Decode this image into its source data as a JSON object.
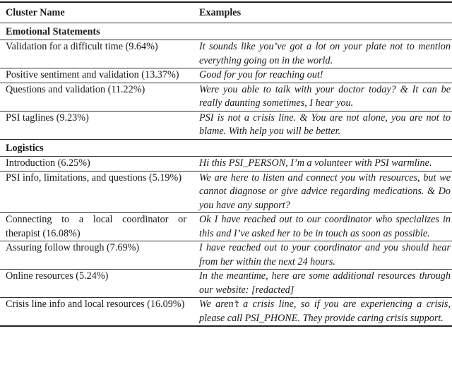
{
  "table": {
    "headers": [
      "Cluster Name",
      "Examples"
    ],
    "sections": [
      {
        "title": "Emotional Statements",
        "rows": [
          {
            "name": "Validation for a difficult time (9.64%)",
            "example": "It sounds like you’ve got a lot on your plate not to men­tion everything going on in the world."
          },
          {
            "name": "Positive sentiment and validation (13.37%)",
            "example": "Good for you for reaching out!"
          },
          {
            "name": "Questions and validation (11.22%)",
            "example": "Were you able to talk with your doctor today? & It can be really daunting sometimes, I hear you."
          },
          {
            "name": "PSI taglines (9.23%)",
            "example": "PSI is not a crisis line.  & You are not alone, you are not to blame. With help you will be better."
          }
        ]
      },
      {
        "title": "Logistics",
        "rows": [
          {
            "name": "Introduction (6.25%)",
            "example": "Hi this PSI_PERSON, I’m a volunteer with PSI warmline."
          },
          {
            "name": "PSI info, limitations, and questions (5.19%)",
            "example": "We are here to listen and connect you with resources, but we cannot diagnose or give advice regarding medi­cations.  & Do you have any support?"
          },
          {
            "name": "Connecting to a local coordinator or therapist (16.08%)",
            "example": "Ok I have reached out to our coordinator who specializes in this and I’ve asked her to be in touch as soon as possible."
          },
          {
            "name": "Assuring follow through (7.69%)",
            "example": "I have reached out to your coordinator and you should hear from her within the next 24 hours."
          },
          {
            "name": "Online resources (5.24%)",
            "example": "In the meantime, here are some additional resources through our website: [redacted]"
          },
          {
            "name": "Crisis line info and local resources (16.09%)",
            "example": "We aren’t a crisis line, so if you are experiencing a crisis, please call PSI_PHONE. They provide caring crisis support."
          }
        ]
      }
    ]
  }
}
